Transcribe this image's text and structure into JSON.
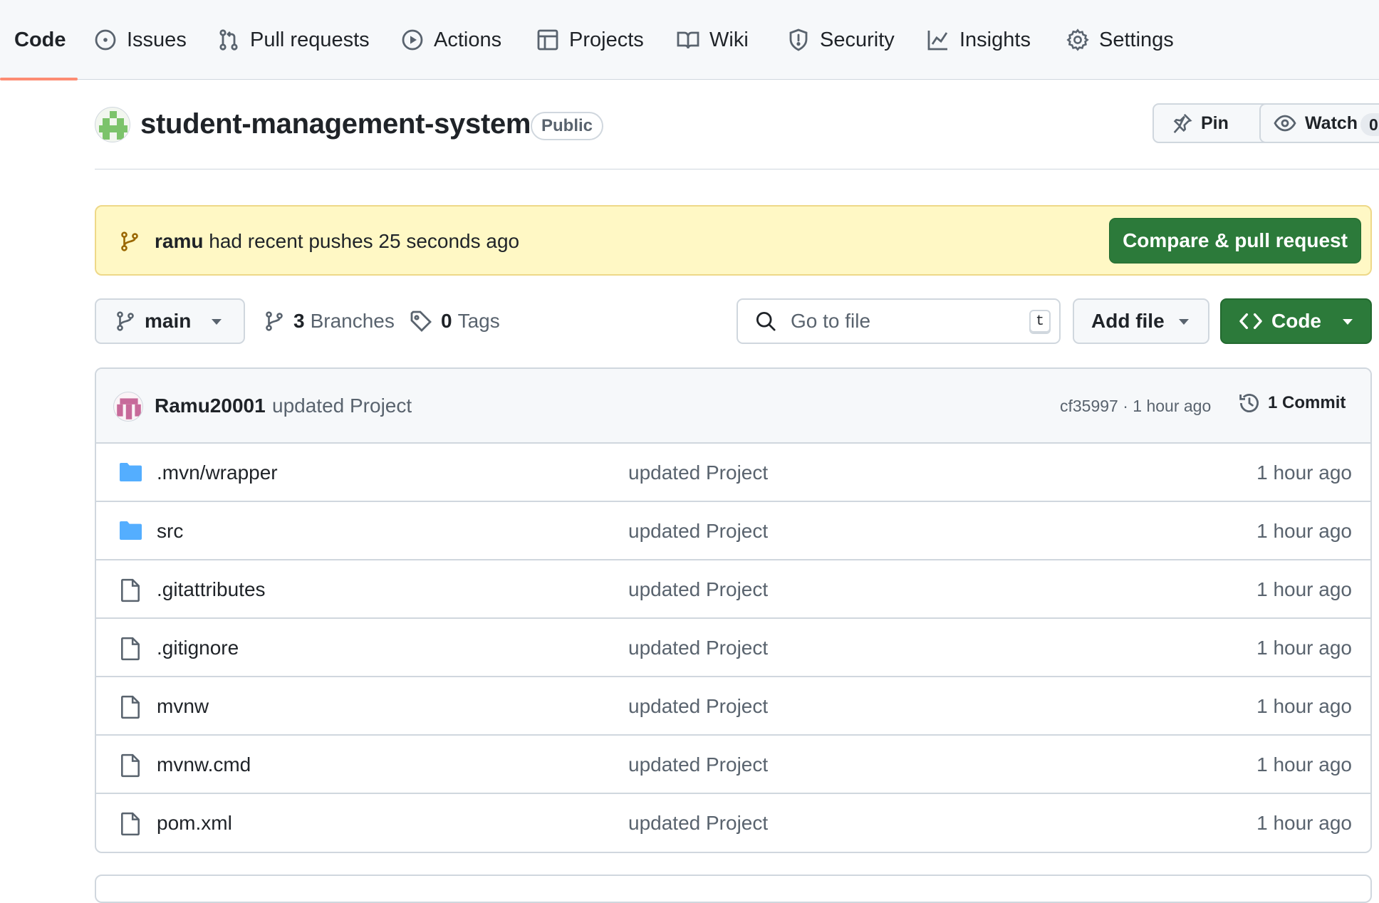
{
  "nav": {
    "tabs": [
      {
        "label": "Code",
        "icon": "code-icon",
        "active": true
      },
      {
        "label": "Issues",
        "icon": "issue-icon"
      },
      {
        "label": "Pull requests",
        "icon": "pull-request-icon"
      },
      {
        "label": "Actions",
        "icon": "play-icon"
      },
      {
        "label": "Projects",
        "icon": "table-icon"
      },
      {
        "label": "Wiki",
        "icon": "book-icon"
      },
      {
        "label": "Security",
        "icon": "shield-icon"
      },
      {
        "label": "Insights",
        "icon": "graph-icon"
      },
      {
        "label": "Settings",
        "icon": "gear-icon"
      }
    ]
  },
  "repo": {
    "name": "student-management-system",
    "visibility": "Public",
    "pin_label": "Pin",
    "watch_label": "Watch",
    "watch_count": "0"
  },
  "banner": {
    "user": "ramu",
    "text": "had recent pushes 25 seconds ago",
    "compare_label": "Compare & pull request"
  },
  "toolbar": {
    "branch": "main",
    "branches_count": "3",
    "branches_label": "Branches",
    "tags_count": "0",
    "tags_label": "Tags",
    "search_placeholder": "Go to file",
    "search_shortcut": "t",
    "add_file_label": "Add file",
    "code_label": "Code"
  },
  "latest_commit": {
    "user": "Ramu20001",
    "message": "updated Project",
    "meta": "cf35997 · 1 hour ago",
    "commit_count": "1 Commit"
  },
  "files": [
    {
      "name": ".mvn/wrapper",
      "type": "folder",
      "message": "updated Project",
      "age": "1 hour ago"
    },
    {
      "name": "src",
      "type": "folder",
      "message": "updated Project",
      "age": "1 hour ago"
    },
    {
      "name": ".gitattributes",
      "type": "file",
      "message": "updated Project",
      "age": "1 hour ago"
    },
    {
      "name": ".gitignore",
      "type": "file",
      "message": "updated Project",
      "age": "1 hour ago"
    },
    {
      "name": "mvnw",
      "type": "file",
      "message": "updated Project",
      "age": "1 hour ago"
    },
    {
      "name": "mvnw.cmd",
      "type": "file",
      "message": "updated Project",
      "age": "1 hour ago"
    },
    {
      "name": "pom.xml",
      "type": "file",
      "message": "updated Project",
      "age": "1 hour ago"
    }
  ],
  "colors": {
    "accent_underline": "#fd8c73",
    "primary_button": "#2c7a3a",
    "banner_bg": "#fff8c5",
    "folder": "#54aeff"
  }
}
